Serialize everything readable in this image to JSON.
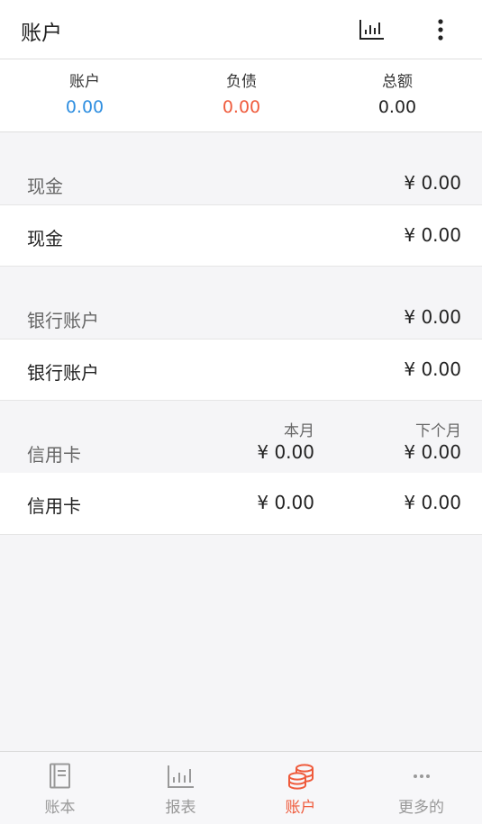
{
  "header": {
    "title": "账户",
    "chart_icon": "bar-chart-icon",
    "more_icon": "more-vertical-icon"
  },
  "summary": {
    "accounts_label": "账户",
    "accounts_value": "0.00",
    "liabilities_label": "负债",
    "liabilities_value": "0.00",
    "total_label": "总额",
    "total_value": "0.00"
  },
  "groups": {
    "cash": {
      "name": "现金",
      "amount": "¥ 0.00",
      "item": {
        "name": "现金",
        "amount": "¥ 0.00"
      }
    },
    "bank": {
      "name": "银行账户",
      "amount": "¥ 0.00",
      "item": {
        "name": "银行账户",
        "amount": "¥ 0.00"
      }
    },
    "credit": {
      "name": "信用卡",
      "this_month_label": "本月",
      "next_month_label": "下个月",
      "this_month_amount": "¥ 0.00",
      "next_month_amount": "¥ 0.00",
      "item": {
        "name": "信用卡",
        "this_month": "¥ 0.00",
        "next_month": "¥ 0.00"
      }
    }
  },
  "tabs": [
    {
      "label": "账本",
      "icon": "ledger-book-icon"
    },
    {
      "label": "报表",
      "icon": "report-chart-icon"
    },
    {
      "label": "账户",
      "icon": "coins-icon"
    },
    {
      "label": "更多的",
      "icon": "more-dots-icon"
    }
  ],
  "colors": {
    "accent": "#ef5b3c",
    "blue": "#2e8ee0",
    "inactive": "#999999"
  }
}
